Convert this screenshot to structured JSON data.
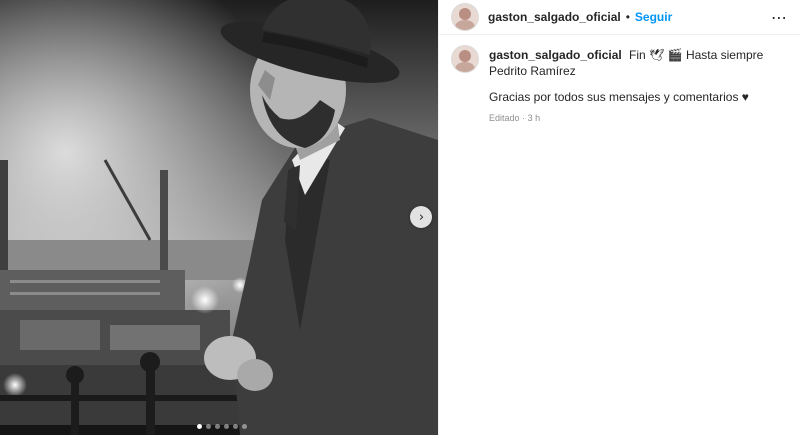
{
  "header": {
    "username": "gaston_salgado_oficial",
    "separator": "•",
    "follow_label": "Seguir",
    "more_icon": "⋯"
  },
  "caption": {
    "username": "gaston_salgado_oficial",
    "text_start": "Fin",
    "emoji_1": "🕊",
    "emoji_2": "🎬",
    "text_end": "Hasta siempre Pedrito Ramírez",
    "line2": "Gracias por todos sus mensajes y comentarios ♥",
    "edited": "Editado",
    "meta_sep": "·",
    "time": "3 h"
  },
  "media": {
    "next_icon": "›",
    "carousel_count": 6,
    "active_index": 0
  },
  "colors": {
    "accent": "#0095f6",
    "text": "#262626",
    "muted": "#8e8e8e"
  }
}
